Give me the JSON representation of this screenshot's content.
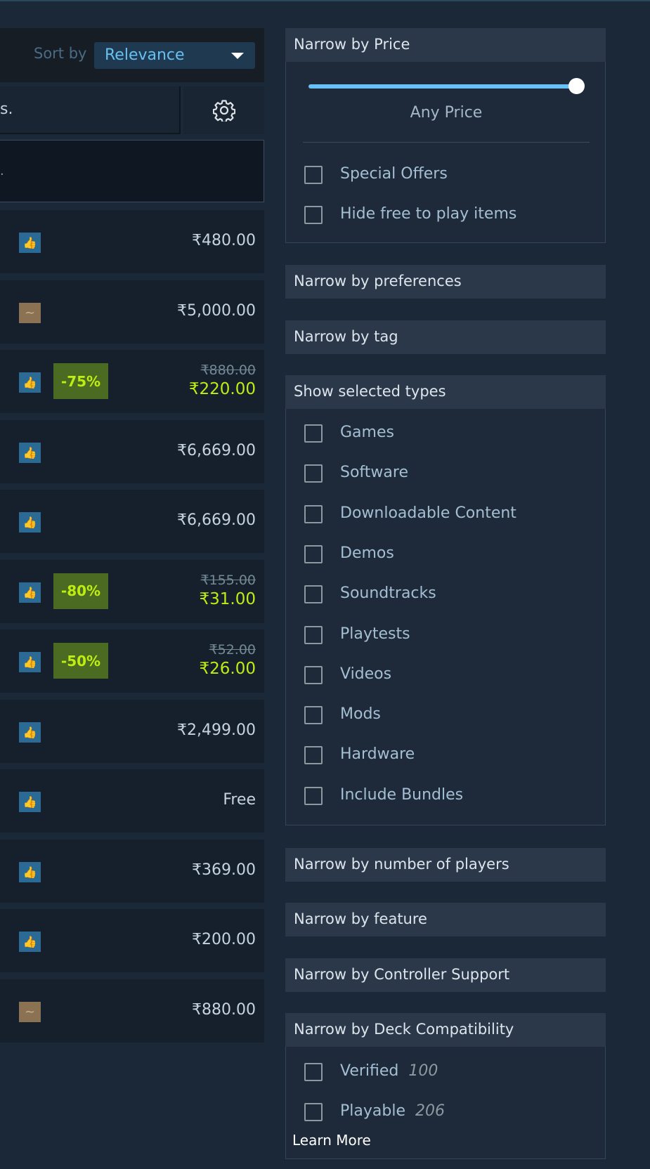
{
  "sort": {
    "label": "Sort by",
    "value": "Relevance"
  },
  "search": {
    "value": "s."
  },
  "results_header": {
    "text": "."
  },
  "results": [
    {
      "review": "positive",
      "review_icon": "thumbs-up-icon",
      "price": "₹480.00"
    },
    {
      "review": "mixed",
      "review_icon": "mixed-review-icon",
      "review_glyph": "~",
      "price": "₹5,000.00"
    },
    {
      "review": "positive",
      "review_icon": "thumbs-up-icon",
      "discount": "-75%",
      "original_price": "₹880.00",
      "final_price": "₹220.00"
    },
    {
      "review": "positive",
      "review_icon": "thumbs-up-icon",
      "price": "₹6,669.00"
    },
    {
      "review": "positive",
      "review_icon": "thumbs-up-icon",
      "price": "₹6,669.00"
    },
    {
      "review": "positive",
      "review_icon": "thumbs-up-icon",
      "discount": "-80%",
      "original_price": "₹155.00",
      "final_price": "₹31.00"
    },
    {
      "review": "positive",
      "review_icon": "thumbs-up-icon",
      "discount": "-50%",
      "original_price": "₹52.00",
      "final_price": "₹26.00"
    },
    {
      "review": "positive",
      "review_icon": "thumbs-up-icon",
      "price": "₹2,499.00"
    },
    {
      "review": "positive",
      "review_icon": "thumbs-up-icon",
      "price": "Free"
    },
    {
      "review": "positive",
      "review_icon": "thumbs-up-icon",
      "price": "₹369.00"
    },
    {
      "review": "positive",
      "review_icon": "thumbs-up-icon",
      "price": "₹200.00"
    },
    {
      "review": "mixed",
      "review_icon": "mixed-review-icon",
      "review_glyph": "~",
      "price": "₹880.00"
    }
  ],
  "filters": {
    "price": {
      "title": "Narrow by Price",
      "slider_label": "Any Price",
      "slider_level": 1.0,
      "options": [
        "Special Offers",
        "Hide free to play items"
      ]
    },
    "preferences": {
      "title": "Narrow by preferences"
    },
    "tag": {
      "title": "Narrow by tag"
    },
    "types": {
      "title": "Show selected types",
      "options": [
        "Games",
        "Software",
        "Downloadable Content",
        "Demos",
        "Soundtracks",
        "Playtests",
        "Videos",
        "Mods",
        "Hardware",
        "Include Bundles"
      ]
    },
    "players": {
      "title": "Narrow by number of players"
    },
    "feature": {
      "title": "Narrow by feature"
    },
    "controller": {
      "title": "Narrow by Controller Support"
    },
    "deck": {
      "title": "Narrow by Deck Compatibility",
      "options": [
        {
          "label": "Verified",
          "count": "100"
        },
        {
          "label": "Playable",
          "count": "206"
        }
      ],
      "learn_more": "Learn More"
    }
  },
  "colors": {
    "background": "#1b2838",
    "accent_blue": "#66c0f4",
    "discount_bg": "#4c6b22",
    "discount_text": "#beee11"
  }
}
